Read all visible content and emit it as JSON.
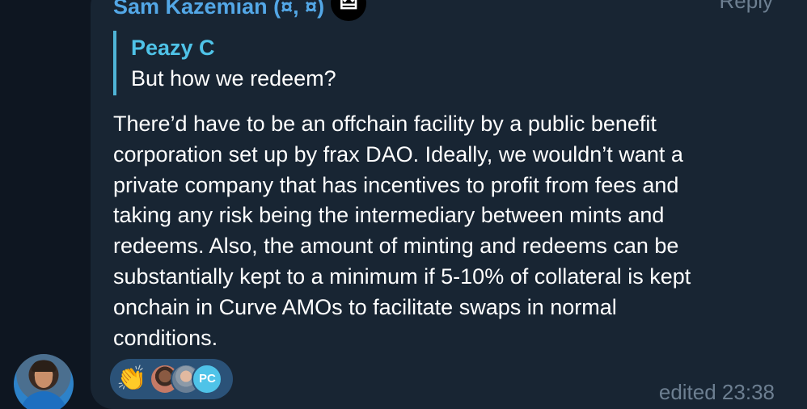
{
  "message": {
    "sender_name": "Sam Kazemian (¤, ¤)",
    "sender_emoji": "🜲",
    "reply_label": "Reply",
    "quote": {
      "author": "Peazy C",
      "text": "But how we redeem?"
    },
    "body_lines": [
      "There’d have to be an offchain facility by a public benefit",
      "corporation set up by frax DAO. Ideally, we wouldn’t want a",
      "private company that has incentives to profit from fees and",
      "taking any risk being the intermediary between mints and",
      "redeems. Also, the amount of minting and redeems can be",
      "substantially kept to a minimum if 5-10% of collateral is kept",
      "onchain in Curve AMOs to facilitate swaps in normal",
      "conditions."
    ],
    "reactions": {
      "emoji": "👏",
      "avatar_initials": "PC"
    },
    "status": "edited 23:38"
  },
  "colors": {
    "background": "#0e1621",
    "bubble": "#182533",
    "sender": "#53a7e6",
    "quote_accent": "#4fc3e8",
    "meta": "#6d7f91",
    "reaction_pill": "#2b5278"
  },
  "icons": {
    "sender_badge": "custom-emoji-badge",
    "reaction": "clapping-hands-icon"
  }
}
